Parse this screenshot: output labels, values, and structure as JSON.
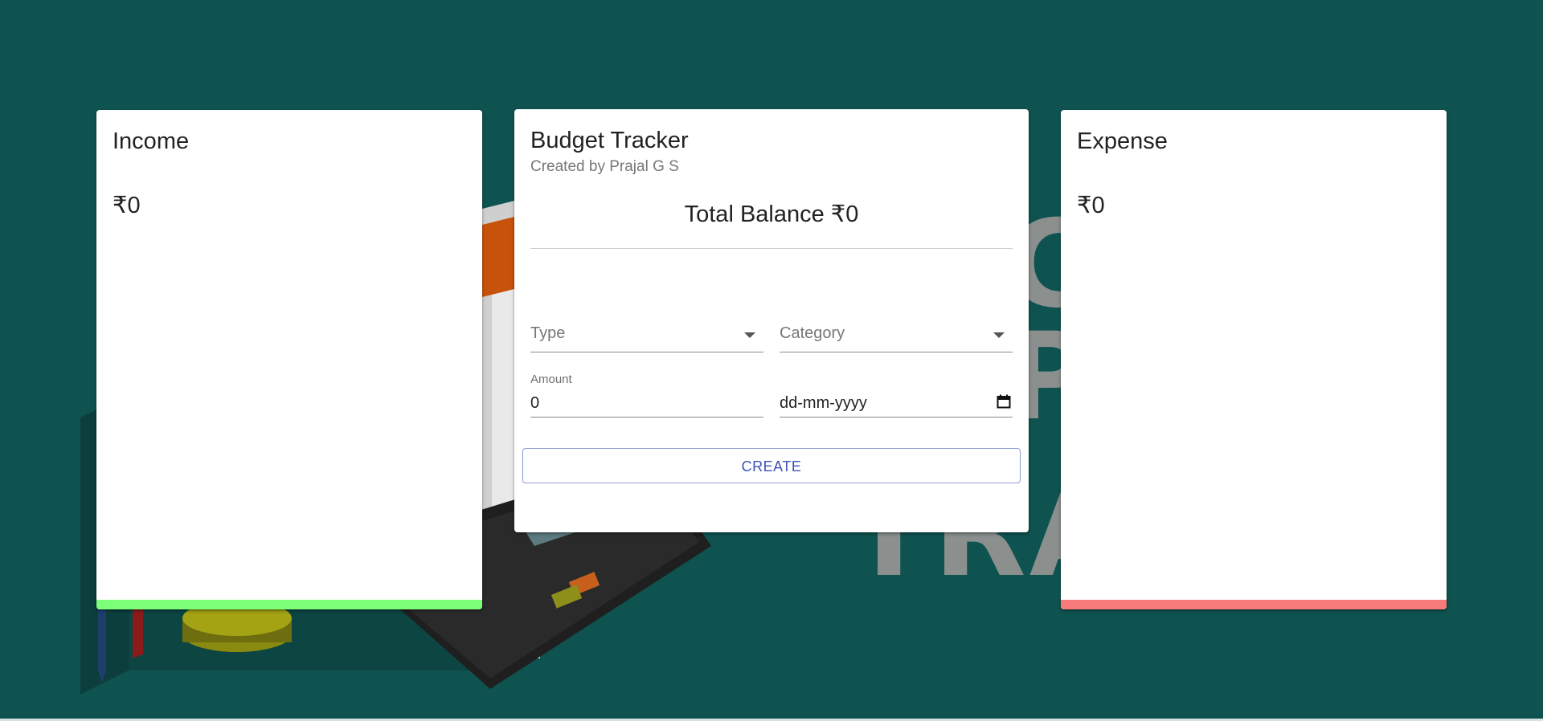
{
  "colors": {
    "background": "#0f5350",
    "income_bar": "#7dff7a",
    "expense_bar": "#f77b7b",
    "button_text": "#3f51b5"
  },
  "income": {
    "title": "Income",
    "amount": "₹0"
  },
  "expense": {
    "title": "Expense",
    "amount": "₹0"
  },
  "main": {
    "title": "Budget Tracker",
    "subtitle": "Created by Prajal G S",
    "balance": "Total Balance ₹0",
    "type": {
      "placeholder": "Type"
    },
    "category": {
      "placeholder": "Category"
    },
    "amount": {
      "label": "Amount",
      "value": "0"
    },
    "date": {
      "value": "dd-mm-yyyy",
      "icon": "calendar-icon"
    },
    "create_label": "CREATE"
  }
}
